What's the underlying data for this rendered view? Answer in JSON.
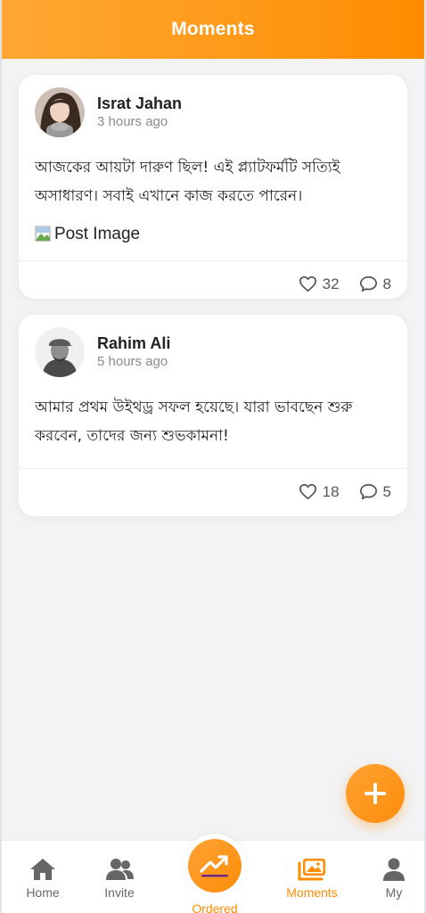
{
  "header": {
    "title": "Moments"
  },
  "posts": [
    {
      "author": "Israt Jahan",
      "time": "3 hours ago",
      "text": "আজকের আয়টা দারুণ ছিল! এই প্ল্যাটফর্মটি সত্যিই অসাধারণ। সবাই এখানে কাজ করতে পারেন।",
      "image_alt": "Post Image",
      "likes": "32",
      "comments": "8"
    },
    {
      "author": "Rahim Ali",
      "time": "5 hours ago",
      "text": "আমার প্রথম উইথড্র সফল হয়েছে। যারা ভাবছেন শুরু করবেন, তাদের জন্য শুভকামনা!",
      "likes": "18",
      "comments": "5"
    }
  ],
  "fab": {
    "icon": "plus-icon"
  },
  "tabbar": {
    "home": "Home",
    "invite": "Invite",
    "ordered": "Ordered",
    "moments": "Moments",
    "my": "My"
  },
  "colors": {
    "accent": "#ff8c00",
    "accent_light": "#ffa732"
  }
}
